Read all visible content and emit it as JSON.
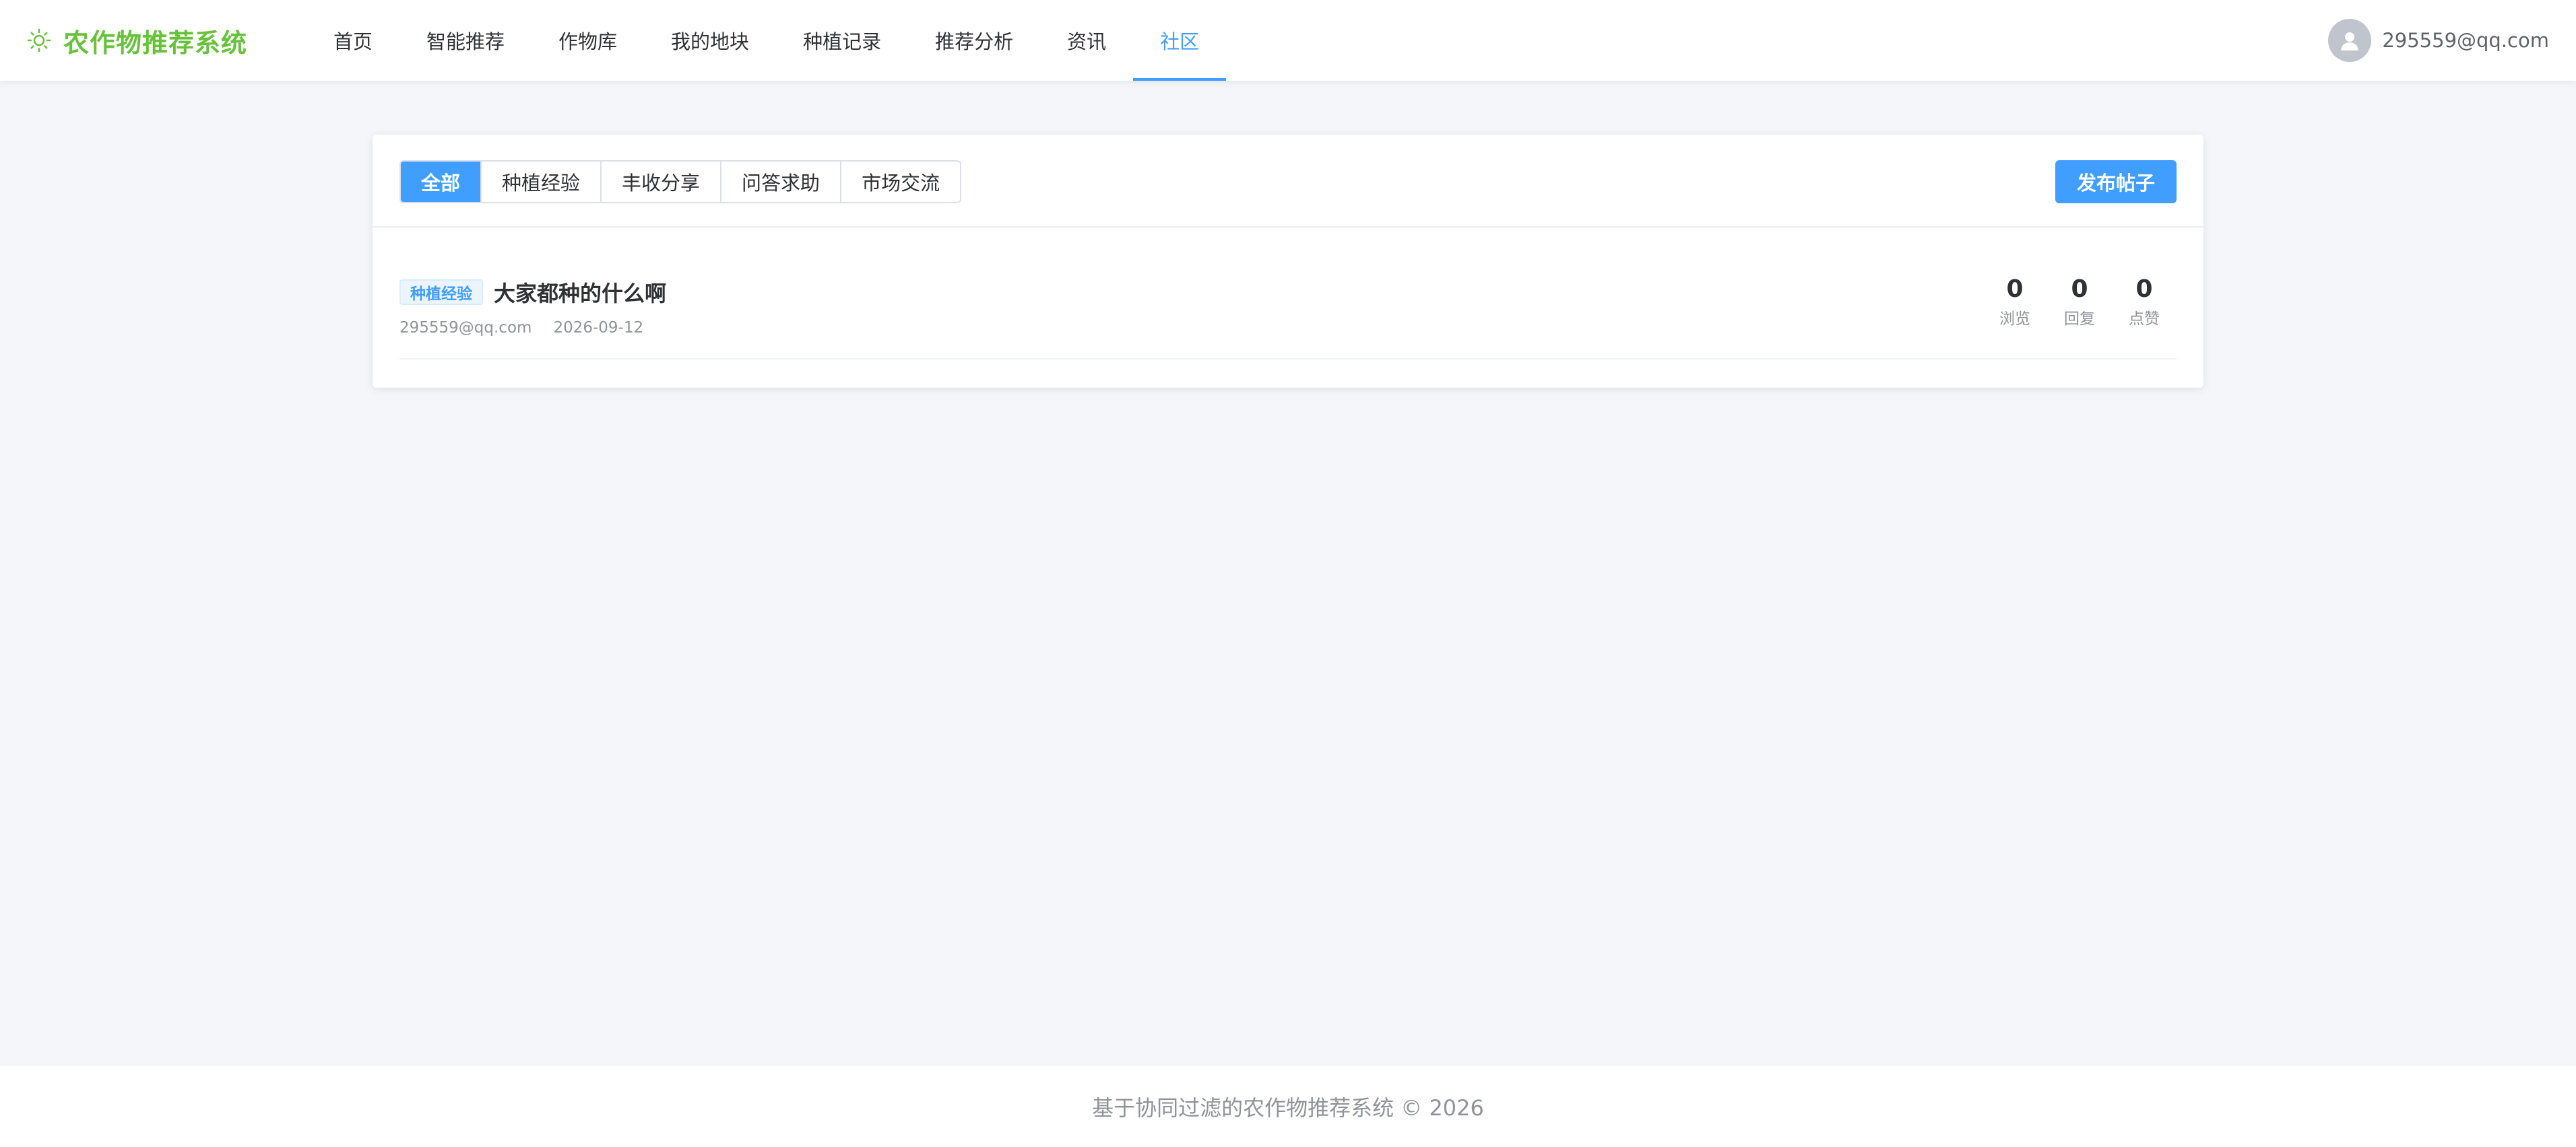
{
  "header": {
    "logo_text": "农作物推荐系统",
    "logo_icon": "sun-icon",
    "nav": [
      {
        "label": "首页"
      },
      {
        "label": "智能推荐"
      },
      {
        "label": "作物库"
      },
      {
        "label": "我的地块"
      },
      {
        "label": "种植记录"
      },
      {
        "label": "推荐分析"
      },
      {
        "label": "资讯"
      },
      {
        "label": "社区",
        "active": true
      }
    ],
    "user_name": "295559@qq.com"
  },
  "community": {
    "tabs": [
      {
        "label": "全部",
        "active": true
      },
      {
        "label": "种植经验"
      },
      {
        "label": "丰收分享"
      },
      {
        "label": "问答求助"
      },
      {
        "label": "市场交流"
      }
    ],
    "publish_label": "发布帖子",
    "posts": [
      {
        "tag": "种植经验",
        "title": "大家都种的什么啊",
        "author": "295559@qq.com",
        "date": "2026-09-12",
        "views": "0",
        "views_label": "浏览",
        "replies": "0",
        "replies_label": "回复",
        "likes": "0",
        "likes_label": "点赞"
      }
    ]
  },
  "footer": {
    "text": "基于协同过滤的农作物推荐系统 © 2026"
  },
  "colors": {
    "brand_green": "#67c23a",
    "accent_blue": "#409eff",
    "page_bg": "#f4f6fa"
  }
}
